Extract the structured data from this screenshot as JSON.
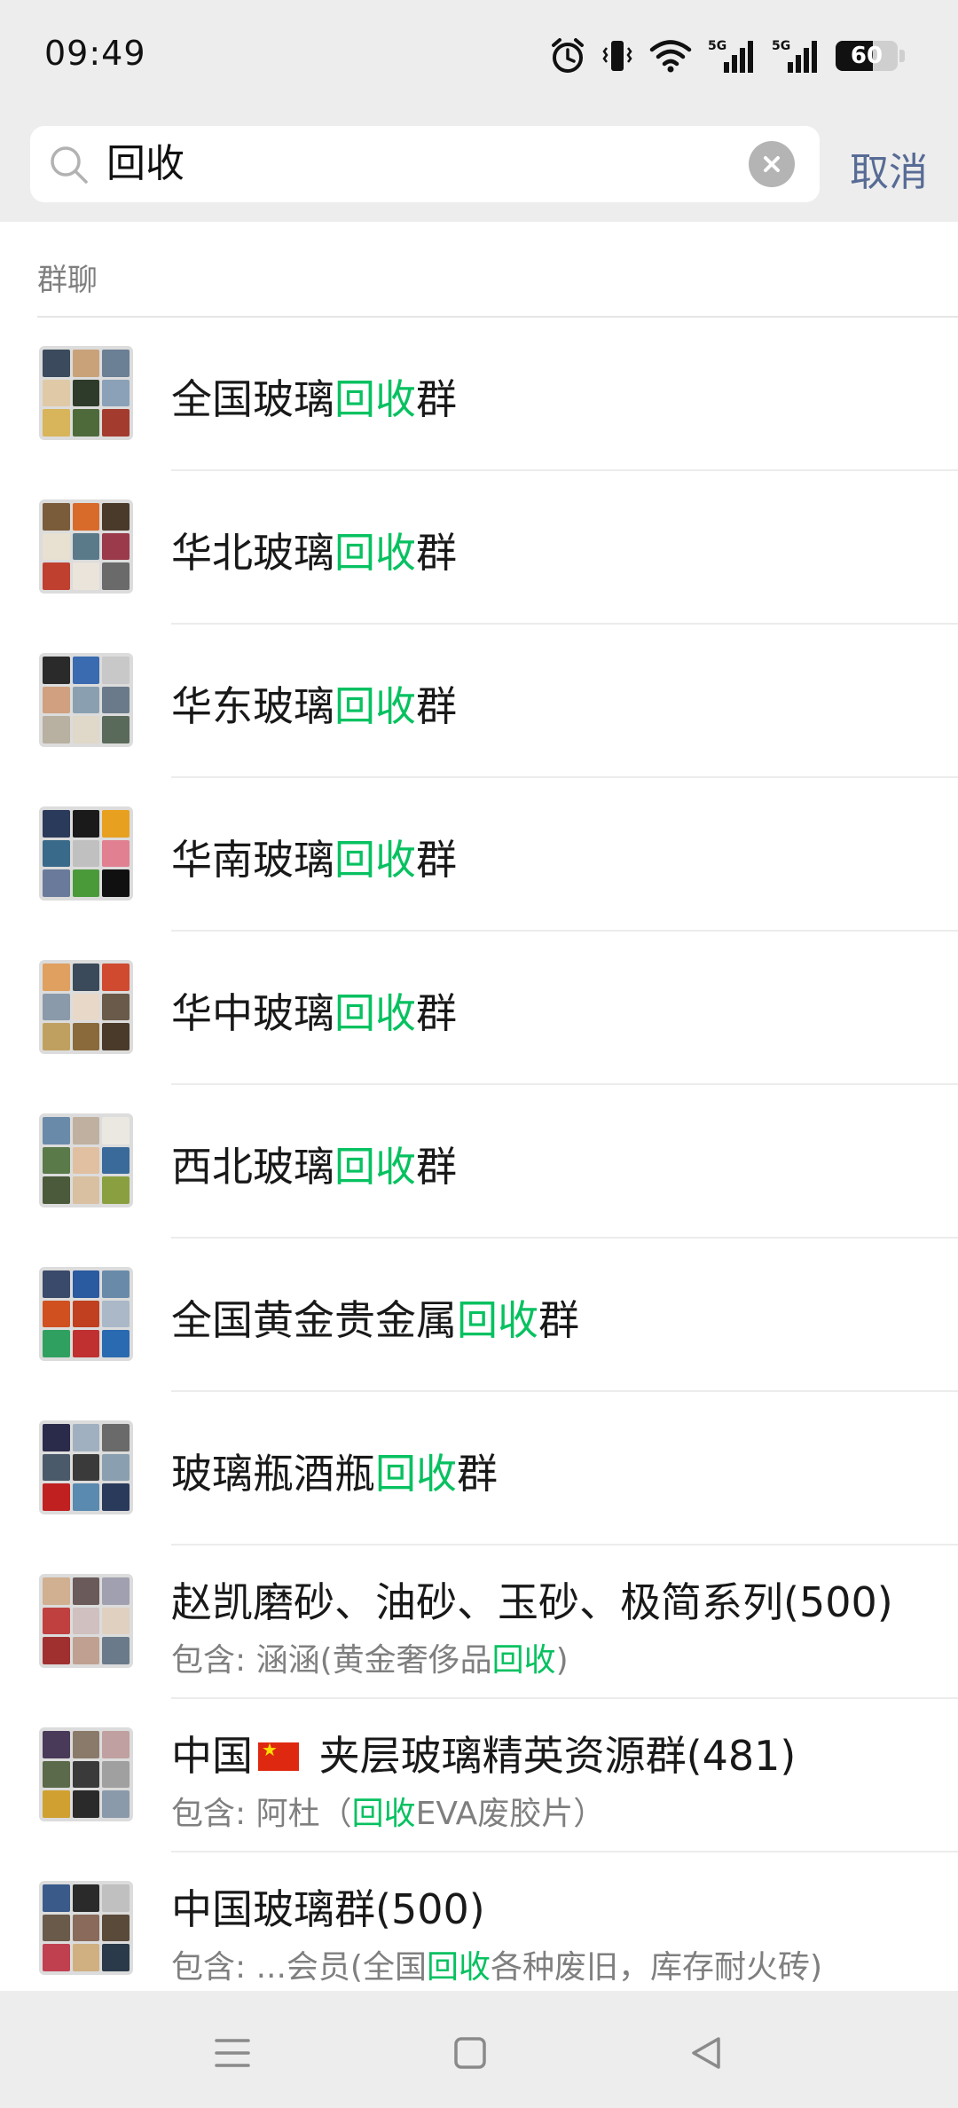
{
  "status_bar": {
    "time": "09:49",
    "battery_level": "60",
    "battery_fraction": 0.6,
    "icons": [
      "alarm-icon",
      "vibrate-icon",
      "wifi-icon",
      "signal-5g-icon",
      "signal-5g-icon",
      "battery-icon"
    ]
  },
  "search": {
    "query": "回收",
    "cancel_label": "取消",
    "icons": [
      "search-icon",
      "clear-icon"
    ]
  },
  "section": {
    "label": "群聊"
  },
  "results": [
    {
      "pre": "全国玻璃",
      "hl": "回收",
      "post": "群"
    },
    {
      "pre": "华北玻璃",
      "hl": "回收",
      "post": "群"
    },
    {
      "pre": "华东玻璃",
      "hl": "回收",
      "post": "群"
    },
    {
      "pre": "华南玻璃",
      "hl": "回收",
      "post": "群"
    },
    {
      "pre": "华中玻璃",
      "hl": "回收",
      "post": "群"
    },
    {
      "pre": "西北玻璃",
      "hl": "回收",
      "post": "群"
    },
    {
      "pre": "全国黄金贵金属",
      "hl": "回收",
      "post": "群"
    },
    {
      "pre": "玻璃瓶酒瓶",
      "hl": "回收",
      "post": "群"
    },
    {
      "title": "赵凯磨砂、油砂、玉砂、极简系列(500)",
      "sub_pre": "包含: 涵涵(黄金奢侈品",
      "sub_hl": "回收",
      "sub_post": ")"
    },
    {
      "title_pre": "中国",
      "title_post": " 夹层玻璃精英资源群(481)",
      "sub_pre": "包含: 阿杜（",
      "sub_hl": "回收",
      "sub_post": "EVA废胶片）"
    },
    {
      "title": "中国玻璃群(500)",
      "sub_pre": "包含: ...会员(全国",
      "sub_hl": "回收",
      "sub_post": "各种废旧，库存耐火砖)"
    }
  ],
  "nav": {
    "icons": [
      "menu-icon",
      "home-icon",
      "back-icon"
    ]
  },
  "colors": {
    "highlight": "#07c160",
    "cancel": "#576b95",
    "header_bg": "#ededed",
    "subtitle": "#7f7f7f"
  }
}
